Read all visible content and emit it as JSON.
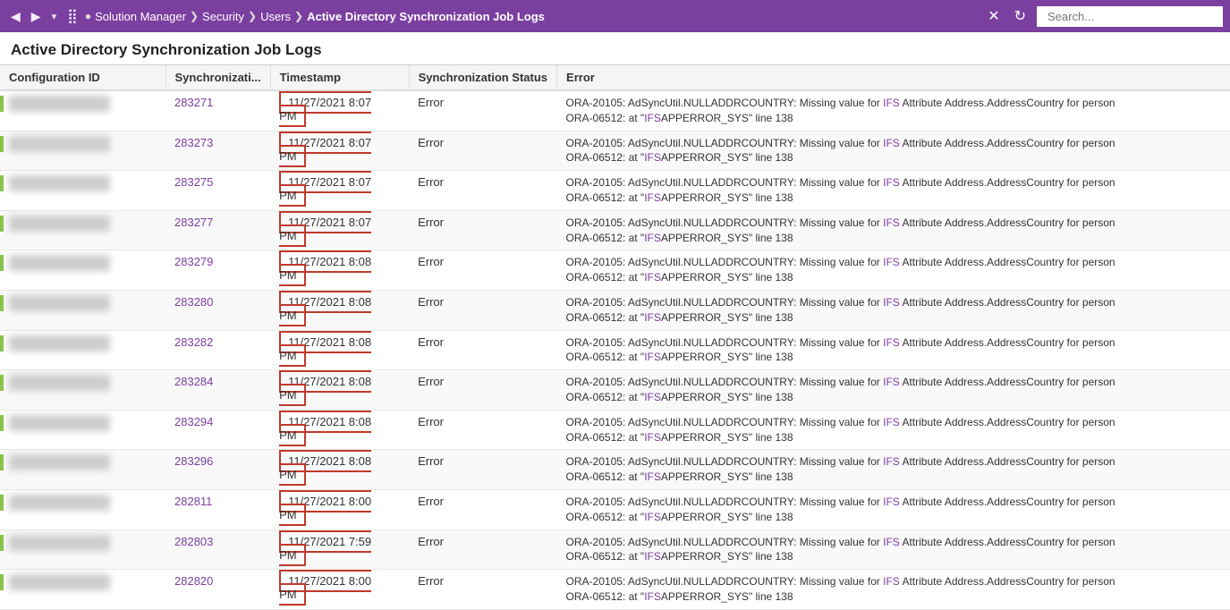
{
  "nav": {
    "back_label": "◀",
    "forward_label": "▶",
    "dropdown_label": "▾",
    "grid_label": "⣿",
    "breadcrumbs": [
      {
        "label": "Solution Manager",
        "active": false
      },
      {
        "label": "Security",
        "active": false
      },
      {
        "label": "Users",
        "active": false
      },
      {
        "label": "Active Directory Synchronization Job Logs",
        "active": true
      }
    ],
    "close_label": "✕",
    "refresh_label": "↻",
    "search_placeholder": "Search..."
  },
  "page": {
    "title": "Active Directory Synchronization Job Logs"
  },
  "table": {
    "columns": [
      {
        "id": "config_id",
        "label": "Configuration ID"
      },
      {
        "id": "sync_id",
        "label": "Synchronizati..."
      },
      {
        "id": "timestamp",
        "label": "Timestamp"
      },
      {
        "id": "status",
        "label": "Synchronization Status"
      },
      {
        "id": "error",
        "label": "Error"
      }
    ],
    "rows": [
      {
        "config_id_blurred": "██████ ████",
        "sync_id": "283271",
        "timestamp": "11/27/2021 8:07 PM",
        "status": "Error",
        "error_line1": "ORA-20105: AdSyncUtil.NULLADDRCOUNTRY: Missing value for IFS Attribute Address.AddressCountry for person",
        "error_line2": "ORA-06512: at \"IFSAPPERROR_SYS\" line 138"
      },
      {
        "config_id_blurred": "██████ ████",
        "sync_id": "283273",
        "timestamp": "11/27/2021 8:07 PM",
        "status": "Error",
        "error_line1": "ORA-20105: AdSyncUtil.NULLADDRCOUNTRY: Missing value for IFS Attribute Address.AddressCountry for person",
        "error_line2": "ORA-06512: at \"IFSAPPERROR_SYS\" line 138"
      },
      {
        "config_id_blurred": "██████ ████",
        "sync_id": "283275",
        "timestamp": "11/27/2021 8:07 PM",
        "status": "Error",
        "error_line1": "ORA-20105: AdSyncUtil.NULLADDRCOUNTRY: Missing value for IFS Attribute Address.AddressCountry for person",
        "error_line2": "ORA-06512: at \"IFSAPPERROR_SYS\" line 138"
      },
      {
        "config_id_blurred": "██████ ████",
        "sync_id": "283277",
        "timestamp": "11/27/2021 8:07 PM",
        "status": "Error",
        "error_line1": "ORA-20105: AdSyncUtil.NULLADDRCOUNTRY: Missing value for IFS Attribute Address.AddressCountry for person",
        "error_line2": "ORA-06512: at \"IFSAPPERROR_SYS\" line 138"
      },
      {
        "config_id_blurred": "██████ ████",
        "sync_id": "283279",
        "timestamp": "11/27/2021 8:08 PM",
        "status": "Error",
        "error_line1": "ORA-20105: AdSyncUtil.NULLADDRCOUNTRY: Missing value for IFS Attribute Address.AddressCountry for person",
        "error_line2": "ORA-06512: at \"IFSAPPERROR_SYS\" line 138"
      },
      {
        "config_id_blurred": "██████ ████",
        "sync_id": "283280",
        "timestamp": "11/27/2021 8:08 PM",
        "status": "Error",
        "error_line1": "ORA-20105: AdSyncUtil.NULLADDRCOUNTRY: Missing value for IFS Attribute Address.AddressCountry for person",
        "error_line2": "ORA-06512: at \"IFSAPPERROR_SYS\" line 138"
      },
      {
        "config_id_blurred": "██████ ████",
        "sync_id": "283282",
        "timestamp": "11/27/2021 8:08 PM",
        "status": "Error",
        "error_line1": "ORA-20105: AdSyncUtil.NULLADDRCOUNTRY: Missing value for IFS Attribute Address.AddressCountry for person",
        "error_line2": "ORA-06512: at \"IFSAPPERROR_SYS\" line 138"
      },
      {
        "config_id_blurred": "██████ ████",
        "sync_id": "283284",
        "timestamp": "11/27/2021 8:08 PM",
        "status": "Error",
        "error_line1": "ORA-20105: AdSyncUtil.NULLADDRCOUNTRY: Missing value for IFS Attribute Address.AddressCountry for person",
        "error_line2": "ORA-06512: at \"IFSAPPERROR_SYS\" line 138"
      },
      {
        "config_id_blurred": "██████ ████",
        "sync_id": "283294",
        "timestamp": "11/27/2021 8:08 PM",
        "status": "Error",
        "error_line1": "ORA-20105: AdSyncUtil.NULLADDRCOUNTRY: Missing value for IFS Attribute Address.AddressCountry for person",
        "error_line2": "ORA-06512: at \"IFSAPPERROR_SYS\" line 138"
      },
      {
        "config_id_blurred": "██████ ████",
        "sync_id": "283296",
        "timestamp": "11/27/2021 8:08 PM",
        "status": "Error",
        "error_line1": "ORA-20105: AdSyncUtil.NULLADDRCOUNTRY: Missing value for IFS Attribute Address.AddressCountry for person",
        "error_line2": "ORA-06512: at \"IFSAPPERROR_SYS\" line 138"
      },
      {
        "config_id_blurred": "██████ ████",
        "sync_id": "282811",
        "timestamp": "11/27/2021 8:00 PM",
        "status": "Error",
        "error_line1": "ORA-20105: AdSyncUtil.NULLADDRCOUNTRY: Missing value for IFS Attribute Address.AddressCountry for person",
        "error_line2": "ORA-06512: at \"IFSAPPERROR_SYS\" line 138"
      },
      {
        "config_id_blurred": "██████ ████",
        "sync_id": "282803",
        "timestamp": "11/27/2021 7:59 PM",
        "status": "Error",
        "error_line1": "ORA-20105: AdSyncUtil.NULLADDRCOUNTRY: Missing value for IFS Attribute Address.AddressCountry for person",
        "error_line2": "ORA-06512: at \"IFSAPPERROR_SYS\" line 138"
      },
      {
        "config_id_blurred": "██████ ████",
        "sync_id": "282820",
        "timestamp": "11/27/2021 8:00 PM",
        "status": "Error",
        "error_line1": "ORA-20105: AdSyncUtil.NULLADDRCOUNTRY: Missing value for IFS Attribute Address.AddressCountry for person",
        "error_line2": "ORA-06512: at \"IFSAPPERROR_SYS\" line 138"
      }
    ]
  },
  "colors": {
    "nav_bg": "#7b3fa0",
    "accent_green": "#8bc34a",
    "timestamp_border": "#c0392b",
    "link_color": "#7b3fa0"
  }
}
